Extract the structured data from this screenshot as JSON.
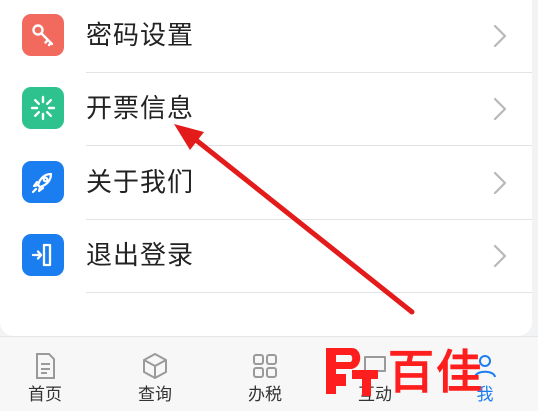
{
  "menu": {
    "items": [
      {
        "label": "密码设置",
        "icon": "key-icon",
        "color": "#f26a5e"
      },
      {
        "label": "开票信息",
        "icon": "invoice-burst-icon",
        "color": "#2ec28e"
      },
      {
        "label": "关于我们",
        "icon": "rocket-icon",
        "color": "#1a7ef0"
      },
      {
        "label": "退出登录",
        "icon": "logout-door-icon",
        "color": "#1a7ef0"
      }
    ]
  },
  "tabbar": {
    "tabs": [
      {
        "label": "首页",
        "icon": "document-icon"
      },
      {
        "label": "查询",
        "icon": "cube-icon"
      },
      {
        "label": "办税",
        "icon": "grid-icon"
      },
      {
        "label": "互动",
        "icon": "chat-icon"
      },
      {
        "label": "我",
        "icon": "user-icon",
        "active_color": "#1a7ef0"
      }
    ]
  },
  "watermark": {
    "text": "百佳",
    "color": "#ff1e1e"
  },
  "annotation": {
    "arrow_color": "#e31b1b"
  }
}
